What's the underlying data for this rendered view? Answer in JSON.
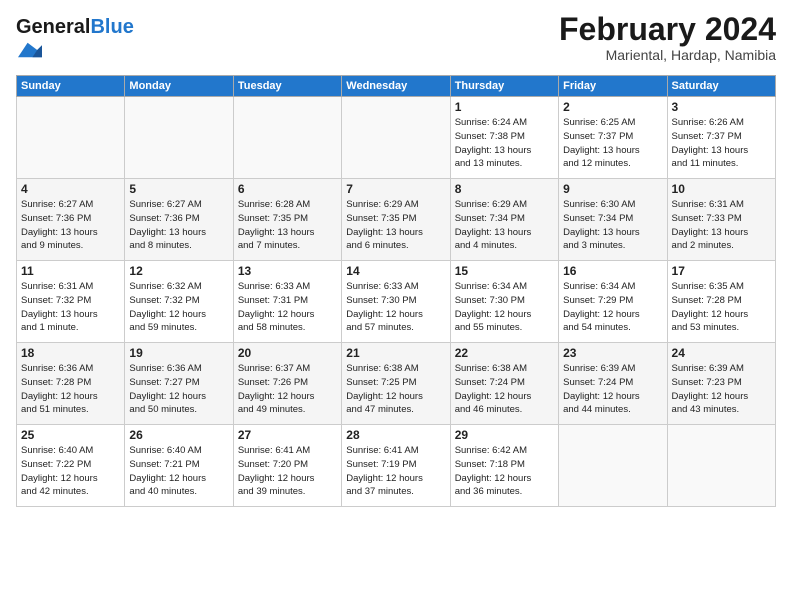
{
  "header": {
    "logo_general": "General",
    "logo_blue": "Blue",
    "month_title": "February 2024",
    "location": "Mariental, Hardap, Namibia"
  },
  "days_of_week": [
    "Sunday",
    "Monday",
    "Tuesday",
    "Wednesday",
    "Thursday",
    "Friday",
    "Saturday"
  ],
  "weeks": [
    [
      {
        "day": "",
        "info": ""
      },
      {
        "day": "",
        "info": ""
      },
      {
        "day": "",
        "info": ""
      },
      {
        "day": "",
        "info": ""
      },
      {
        "day": "1",
        "info": "Sunrise: 6:24 AM\nSunset: 7:38 PM\nDaylight: 13 hours\nand 13 minutes."
      },
      {
        "day": "2",
        "info": "Sunrise: 6:25 AM\nSunset: 7:37 PM\nDaylight: 13 hours\nand 12 minutes."
      },
      {
        "day": "3",
        "info": "Sunrise: 6:26 AM\nSunset: 7:37 PM\nDaylight: 13 hours\nand 11 minutes."
      }
    ],
    [
      {
        "day": "4",
        "info": "Sunrise: 6:27 AM\nSunset: 7:36 PM\nDaylight: 13 hours\nand 9 minutes."
      },
      {
        "day": "5",
        "info": "Sunrise: 6:27 AM\nSunset: 7:36 PM\nDaylight: 13 hours\nand 8 minutes."
      },
      {
        "day": "6",
        "info": "Sunrise: 6:28 AM\nSunset: 7:35 PM\nDaylight: 13 hours\nand 7 minutes."
      },
      {
        "day": "7",
        "info": "Sunrise: 6:29 AM\nSunset: 7:35 PM\nDaylight: 13 hours\nand 6 minutes."
      },
      {
        "day": "8",
        "info": "Sunrise: 6:29 AM\nSunset: 7:34 PM\nDaylight: 13 hours\nand 4 minutes."
      },
      {
        "day": "9",
        "info": "Sunrise: 6:30 AM\nSunset: 7:34 PM\nDaylight: 13 hours\nand 3 minutes."
      },
      {
        "day": "10",
        "info": "Sunrise: 6:31 AM\nSunset: 7:33 PM\nDaylight: 13 hours\nand 2 minutes."
      }
    ],
    [
      {
        "day": "11",
        "info": "Sunrise: 6:31 AM\nSunset: 7:32 PM\nDaylight: 13 hours\nand 1 minute."
      },
      {
        "day": "12",
        "info": "Sunrise: 6:32 AM\nSunset: 7:32 PM\nDaylight: 12 hours\nand 59 minutes."
      },
      {
        "day": "13",
        "info": "Sunrise: 6:33 AM\nSunset: 7:31 PM\nDaylight: 12 hours\nand 58 minutes."
      },
      {
        "day": "14",
        "info": "Sunrise: 6:33 AM\nSunset: 7:30 PM\nDaylight: 12 hours\nand 57 minutes."
      },
      {
        "day": "15",
        "info": "Sunrise: 6:34 AM\nSunset: 7:30 PM\nDaylight: 12 hours\nand 55 minutes."
      },
      {
        "day": "16",
        "info": "Sunrise: 6:34 AM\nSunset: 7:29 PM\nDaylight: 12 hours\nand 54 minutes."
      },
      {
        "day": "17",
        "info": "Sunrise: 6:35 AM\nSunset: 7:28 PM\nDaylight: 12 hours\nand 53 minutes."
      }
    ],
    [
      {
        "day": "18",
        "info": "Sunrise: 6:36 AM\nSunset: 7:28 PM\nDaylight: 12 hours\nand 51 minutes."
      },
      {
        "day": "19",
        "info": "Sunrise: 6:36 AM\nSunset: 7:27 PM\nDaylight: 12 hours\nand 50 minutes."
      },
      {
        "day": "20",
        "info": "Sunrise: 6:37 AM\nSunset: 7:26 PM\nDaylight: 12 hours\nand 49 minutes."
      },
      {
        "day": "21",
        "info": "Sunrise: 6:38 AM\nSunset: 7:25 PM\nDaylight: 12 hours\nand 47 minutes."
      },
      {
        "day": "22",
        "info": "Sunrise: 6:38 AM\nSunset: 7:24 PM\nDaylight: 12 hours\nand 46 minutes."
      },
      {
        "day": "23",
        "info": "Sunrise: 6:39 AM\nSunset: 7:24 PM\nDaylight: 12 hours\nand 44 minutes."
      },
      {
        "day": "24",
        "info": "Sunrise: 6:39 AM\nSunset: 7:23 PM\nDaylight: 12 hours\nand 43 minutes."
      }
    ],
    [
      {
        "day": "25",
        "info": "Sunrise: 6:40 AM\nSunset: 7:22 PM\nDaylight: 12 hours\nand 42 minutes."
      },
      {
        "day": "26",
        "info": "Sunrise: 6:40 AM\nSunset: 7:21 PM\nDaylight: 12 hours\nand 40 minutes."
      },
      {
        "day": "27",
        "info": "Sunrise: 6:41 AM\nSunset: 7:20 PM\nDaylight: 12 hours\nand 39 minutes."
      },
      {
        "day": "28",
        "info": "Sunrise: 6:41 AM\nSunset: 7:19 PM\nDaylight: 12 hours\nand 37 minutes."
      },
      {
        "day": "29",
        "info": "Sunrise: 6:42 AM\nSunset: 7:18 PM\nDaylight: 12 hours\nand 36 minutes."
      },
      {
        "day": "",
        "info": ""
      },
      {
        "day": "",
        "info": ""
      }
    ]
  ]
}
